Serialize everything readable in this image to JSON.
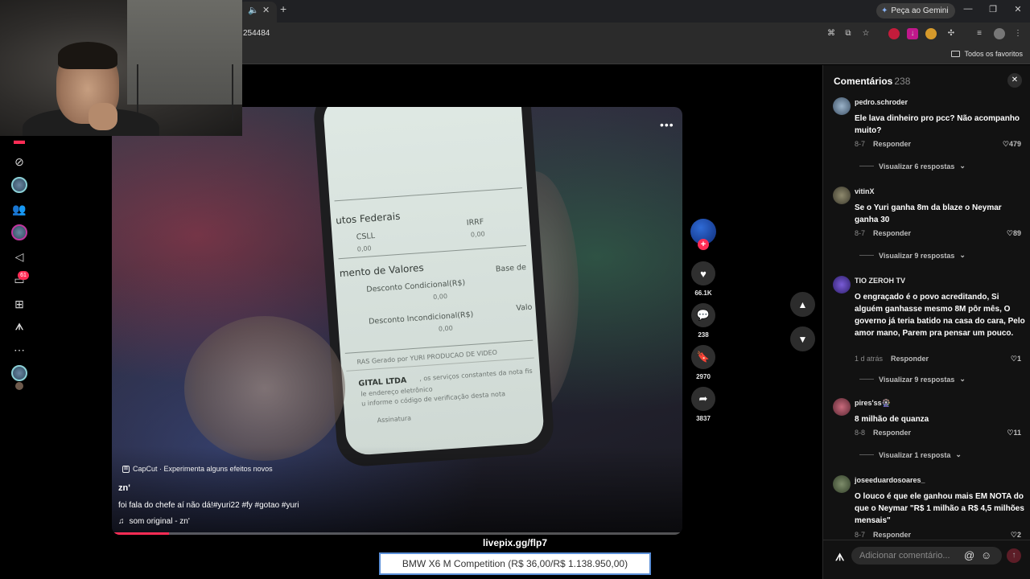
{
  "browser": {
    "url_fragment": "254484",
    "gemini_label": "Peça ao Gemini",
    "bookmarks_label": "Todos os favoritos",
    "new_tab": "+",
    "tab_close": "✕"
  },
  "leftnav": {
    "inbox_badge": "61"
  },
  "video": {
    "capcut_text": "CapCut · Experimenta alguns efeitos novos",
    "author": "zn'",
    "caption": "foi fala do chefe aí não dá!#yuri22 #fy #gotao #yuri",
    "music": "som original - zn'",
    "progress_fraction": 0.1,
    "document": {
      "heading1": "utos Federais",
      "csll": "CSLL",
      "csll_val": "0,00",
      "irrf": "IRRF",
      "irrf_val": "0,00",
      "heading2": "mento de Valores",
      "desc_cond": "Desconto Condicional(R$)",
      "desc_cond_val": "0,00",
      "base": "Base de",
      "desc_incond": "Desconto Incondicional(R$)",
      "desc_incond_val": "0,00",
      "val": "Valo",
      "gerado": "RAS  Gerado por YURI PRODUCAO DE VIDEO",
      "ltda": "GITAL LTDA",
      "ltda_rest": ", os serviços constantes da nota fis",
      "endereco": "le endereço eletrônico",
      "informe": "u informe o código de verificação desta nota",
      "assinatura": "Assinatura"
    }
  },
  "actions": {
    "likes": "66.1K",
    "comments": "238",
    "saves": "2970",
    "shares": "3837"
  },
  "stream": {
    "livepix": "livepix.gg/flp7",
    "donation": "BMW X6 M Competition (R$ 36,00/R$ 1.138.950,00)"
  },
  "comments_panel": {
    "title": "Comentários",
    "count": "238",
    "reply_label": "Responder",
    "input_placeholder": "Adicionar comentário...",
    "items": [
      {
        "user": "pedro.schroder",
        "text": "Ele lava dinheiro pro pcc? Não acompanho muito?",
        "date": "8-7",
        "likes": "479",
        "view_replies": "Visualizar 6 respostas"
      },
      {
        "user": "vitinX",
        "text": "Se o Yuri ganha 8m da blaze o Neymar ganha 30",
        "date": "8-7",
        "likes": "89",
        "view_replies": "Visualizar 9 respostas"
      },
      {
        "user": "TIO ZEROH TV",
        "text": "O engraçado é o povo acreditando, Si alguém ganhasse mesmo 8M pôr mês, O governo já teria batido na casa do cara, Pelo amor mano, Parem pra pensar um pouco.",
        "date": "1 d atrás",
        "likes": "1",
        "view_replies": "Visualizar 9 respostas"
      },
      {
        "user": "pires'ss🎡",
        "text": "8 milhão de quanza",
        "date": "8-8",
        "likes": "11",
        "view_replies": "Visualizar 1 resposta"
      },
      {
        "user": "joseeduardosoares_",
        "text": "O louco é que ele ganhou mais EM NOTA do que o Neymar \"R$ 1 milhão a R$ 4,5 milhões mensais\"",
        "date": "8-7",
        "likes": "2",
        "view_replies": ""
      }
    ]
  },
  "colors": {
    "accent": "#fe2c55",
    "panel_bg": "#121212"
  },
  "icons": {
    "left_nav": [
      "explore-icon",
      "avatar",
      "friends-icon",
      "live-avatar",
      "send-icon",
      "inbox-icon",
      "upload-icon",
      "logo-icon",
      "more-icon",
      "profile-avatar"
    ],
    "actions": [
      "heart-icon",
      "comment-icon",
      "bookmark-icon",
      "share-icon"
    ]
  }
}
